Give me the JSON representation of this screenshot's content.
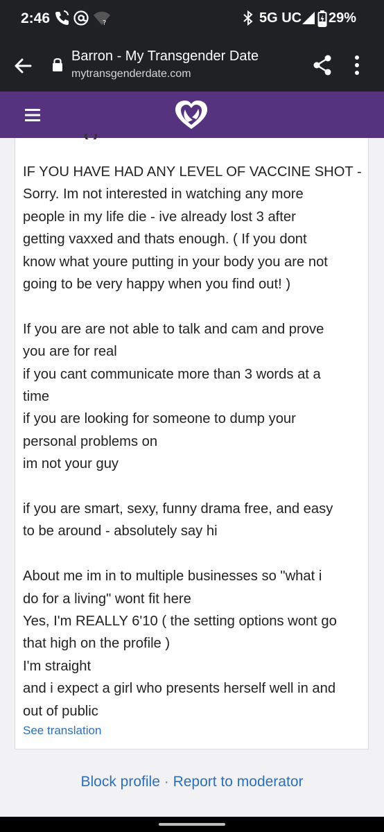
{
  "status_bar": {
    "time": "2:46",
    "network": "5G UC",
    "battery": "29%",
    "icons": [
      "phone-wifi-icon",
      "at-icon",
      "wifi-unknown-icon",
      "bluetooth-icon",
      "signal-icon",
      "battery-charging-icon"
    ]
  },
  "browser": {
    "page_title": "Barron - My Transgender Date",
    "url": "mytransgenderdate.com",
    "icons": [
      "back-arrow-icon",
      "lock-icon",
      "share-icon",
      "overflow-menu-icon"
    ]
  },
  "site_header": {
    "icons": [
      "hamburger-menu-icon",
      "heart-logo-icon"
    ],
    "colors": {
      "header_bg": "#56337f"
    }
  },
  "profile": {
    "lines": [
      "IF YOU HAVE HAD ANY LEVEL OF VACCINE SHOT -",
      "Sorry. Im not interested in watching any more",
      "people in my life die - ive already lost 3 after",
      "getting vaxxed and thats enough. ( If you dont",
      "know what youre putting in your body you are not",
      "going to be very happy when you find out! )",
      "",
      "If you are are not able to talk and cam and prove",
      "you are for real",
      "if you cant communicate more than 3 words at a",
      "time",
      "if you are looking for someone to dump your",
      "personal problems on",
      "im not your guy",
      "",
      "if you are smart, sexy, funny drama free, and easy",
      "to be around - absolutely say hi",
      "",
      "About me im in to multiple businesses so \"what i",
      "do for a living\" wont fit here",
      "Yes, I'm REALLY 6'10 ( the setting options wont go",
      "that high on the profile )",
      "I'm straight",
      "and i expect a girl who presents herself well in and",
      "out of public"
    ],
    "see_translation": "See translation"
  },
  "footer": {
    "block_profile": "Block profile",
    "separator": "·",
    "report": "Report to moderator"
  },
  "colors": {
    "link": "#2a6fbb",
    "system_bar": "#202124"
  }
}
